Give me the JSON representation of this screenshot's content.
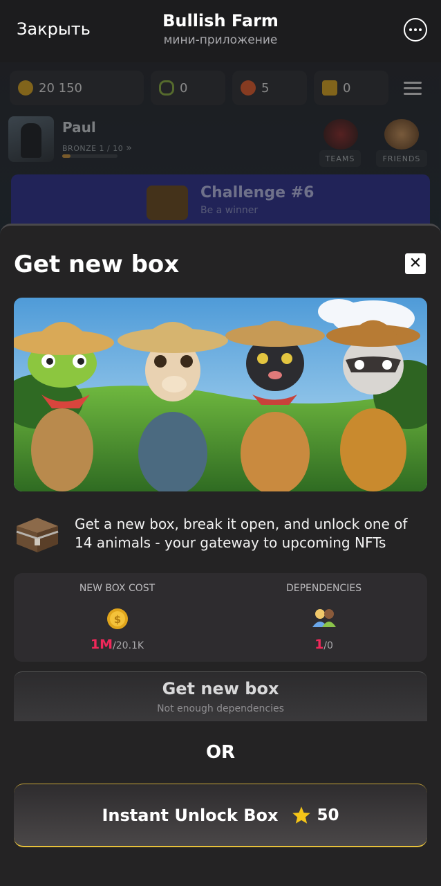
{
  "header": {
    "close_label": "Закрыть",
    "title": "Bullish Farm",
    "subtitle": "мини-приложение"
  },
  "resources": {
    "coins": "20 150",
    "links": "0",
    "timer": "5",
    "keys": "0"
  },
  "profile": {
    "name": "Paul",
    "rank": "BRONZE 1 / 10",
    "rank_progress": 0.1
  },
  "tiles": {
    "teams": "TEAMS",
    "friends": "FRIENDS"
  },
  "challenge": {
    "title": "Challenge #6",
    "subtitle": "Be a winner"
  },
  "sheet": {
    "title": "Get new box",
    "info_text": "Get a new box, break it open, and unlock one of 14 animals - your gateway to upcoming NFTs",
    "cost_label": "NEW BOX COST",
    "cost_required": "1M",
    "cost_have": "/20.1K",
    "deps_label": "DEPENDENCIES",
    "deps_required": "1",
    "deps_have": "/0",
    "get_button_label": "Get new box",
    "get_button_sub": "Not enough dependencies",
    "or_label": "OR",
    "instant_label": "Instant Unlock Box",
    "instant_price": "50"
  },
  "colors": {
    "accent_red": "#f0285a",
    "gold": "#e8c23a",
    "sheet_bg": "#242324"
  }
}
